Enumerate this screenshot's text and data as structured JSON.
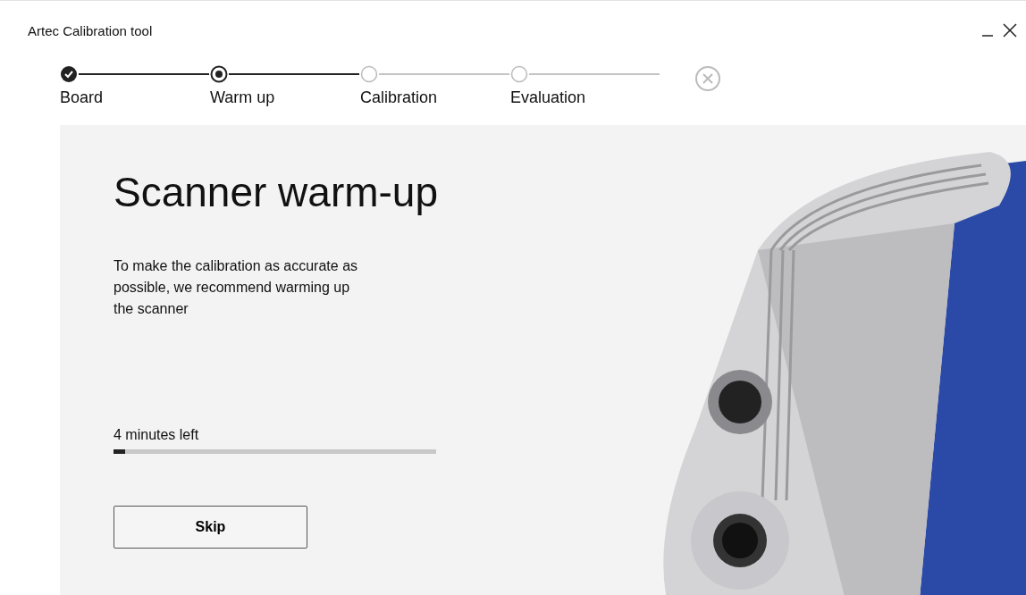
{
  "window": {
    "title": "Artec Calibration tool"
  },
  "steps": [
    {
      "label": "Board",
      "completed": true,
      "selected": false
    },
    {
      "label": "Warm up",
      "completed": false,
      "selected": true
    },
    {
      "label": "Calibration",
      "completed": false,
      "selected": false
    },
    {
      "label": "Evaluation",
      "completed": false,
      "selected": false
    }
  ],
  "heading": "Scanner warm-up",
  "description": "To make the calibration as accurate as possible, we recommend warming up the scanner",
  "progress": {
    "reading": "4 minutes left",
    "level": 0.035
  },
  "buttons": [
    {
      "label": "Skip"
    }
  ]
}
